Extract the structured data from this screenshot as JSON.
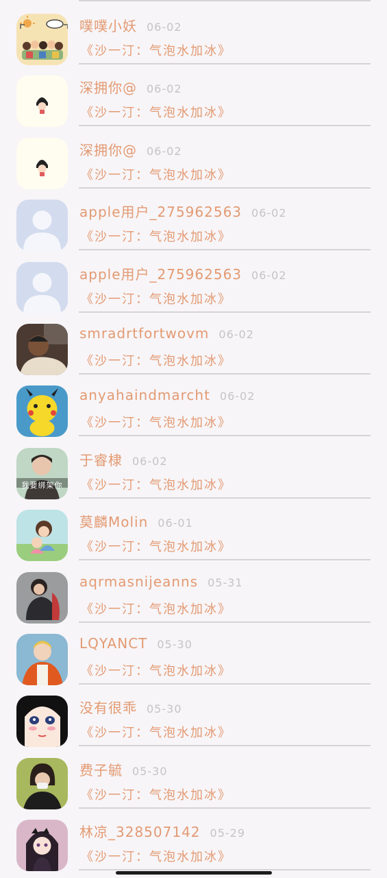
{
  "rows": [
    {
      "name": "噗噗小妖",
      "date": "06-02",
      "message": "《沙一汀：气泡水加冰》",
      "avatar": "group-cartoon"
    },
    {
      "name": "深拥你@",
      "date": "06-02",
      "message": "《沙一汀：气泡水加冰》",
      "avatar": "maruko"
    },
    {
      "name": "深拥你@",
      "date": "06-02",
      "message": "《沙一汀：气泡水加冰》",
      "avatar": "maruko"
    },
    {
      "name": "apple用户_275962563",
      "date": "06-02",
      "message": "《沙一汀：气泡水加冰》",
      "avatar": "default"
    },
    {
      "name": "apple用户_275962563",
      "date": "06-02",
      "message": "《沙一汀：气泡水加冰》",
      "avatar": "default"
    },
    {
      "name": "smradrtfortwovm",
      "date": "06-02",
      "message": "《沙一汀：气泡水加冰》",
      "avatar": "photo-man"
    },
    {
      "name": "anyahaindmarcht",
      "date": "06-02",
      "message": "《沙一汀：气泡水加冰》",
      "avatar": "pikachu"
    },
    {
      "name": "于睿棣",
      "date": "06-02",
      "message": "《沙一汀：气泡水加冰》",
      "avatar": "photo-boy"
    },
    {
      "name": "莫麟Molin",
      "date": "06-01",
      "message": "《沙一汀：气泡水加冰》",
      "avatar": "cartoon-couple"
    },
    {
      "name": "aqrmasnijeanns",
      "date": "05-31",
      "message": "《沙一汀：气泡水加冰》",
      "avatar": "photo-sitting"
    },
    {
      "name": "LQYANCT",
      "date": "05-30",
      "message": "《沙一汀：气泡水加冰》",
      "avatar": "photo-orange"
    },
    {
      "name": "没有很乖",
      "date": "05-30",
      "message": "《沙一汀：气泡水加冰》",
      "avatar": "anime-face"
    },
    {
      "name": "费子毓",
      "date": "05-30",
      "message": "《沙一汀：气泡水加冰》",
      "avatar": "photo-girl"
    },
    {
      "name": "林凉_328507142",
      "date": "05-29",
      "message": "《沙一汀：气泡水加冰》",
      "avatar": "anime-girl"
    }
  ],
  "avatar_text": {
    "photo-boy": "我要绑架你"
  },
  "colors": {
    "accent": "#e39a72",
    "date": "#c6c3c6",
    "divider": "#d6d3d6",
    "background": "#f7f5f8"
  }
}
